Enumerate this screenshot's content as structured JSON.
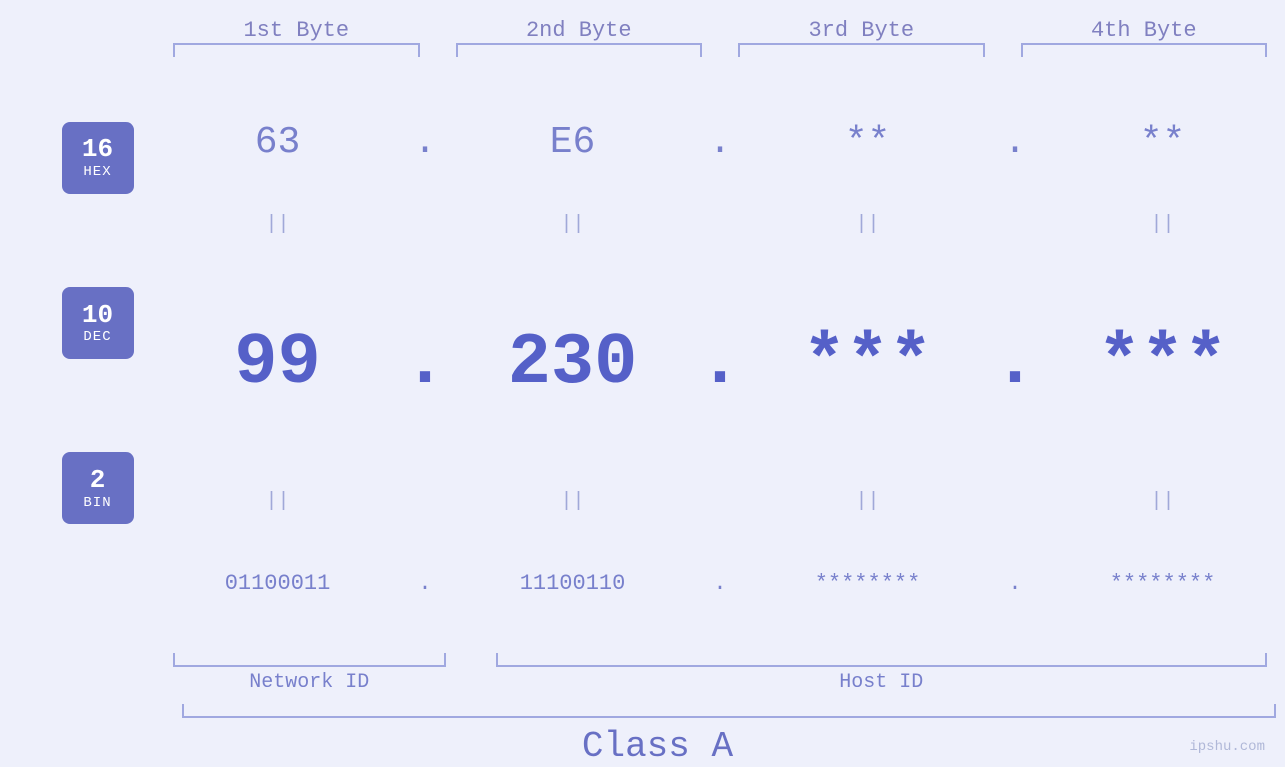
{
  "headers": {
    "byte1": "1st Byte",
    "byte2": "2nd Byte",
    "byte3": "3rd Byte",
    "byte4": "4th Byte"
  },
  "bases": [
    {
      "number": "16",
      "name": "HEX"
    },
    {
      "number": "10",
      "name": "DEC"
    },
    {
      "number": "2",
      "name": "BIN"
    }
  ],
  "hex_row": {
    "b1": "63",
    "d1": ".",
    "b2": "E6",
    "d2": ".",
    "b3": "**",
    "d3": ".",
    "b4": "**"
  },
  "dec_row": {
    "b1": "99",
    "d1": ".",
    "b2": "230",
    "d2": ".",
    "b3": "***",
    "d3": ".",
    "b4": "***"
  },
  "bin_row": {
    "b1": "01100011",
    "d1": ".",
    "b2": "11100110",
    "d2": ".",
    "b3": "********",
    "d3": ".",
    "b4": "********"
  },
  "labels": {
    "network_id": "Network ID",
    "host_id": "Host ID",
    "class": "Class A"
  },
  "footer": "ipshu.com",
  "eq_symbol": "||"
}
